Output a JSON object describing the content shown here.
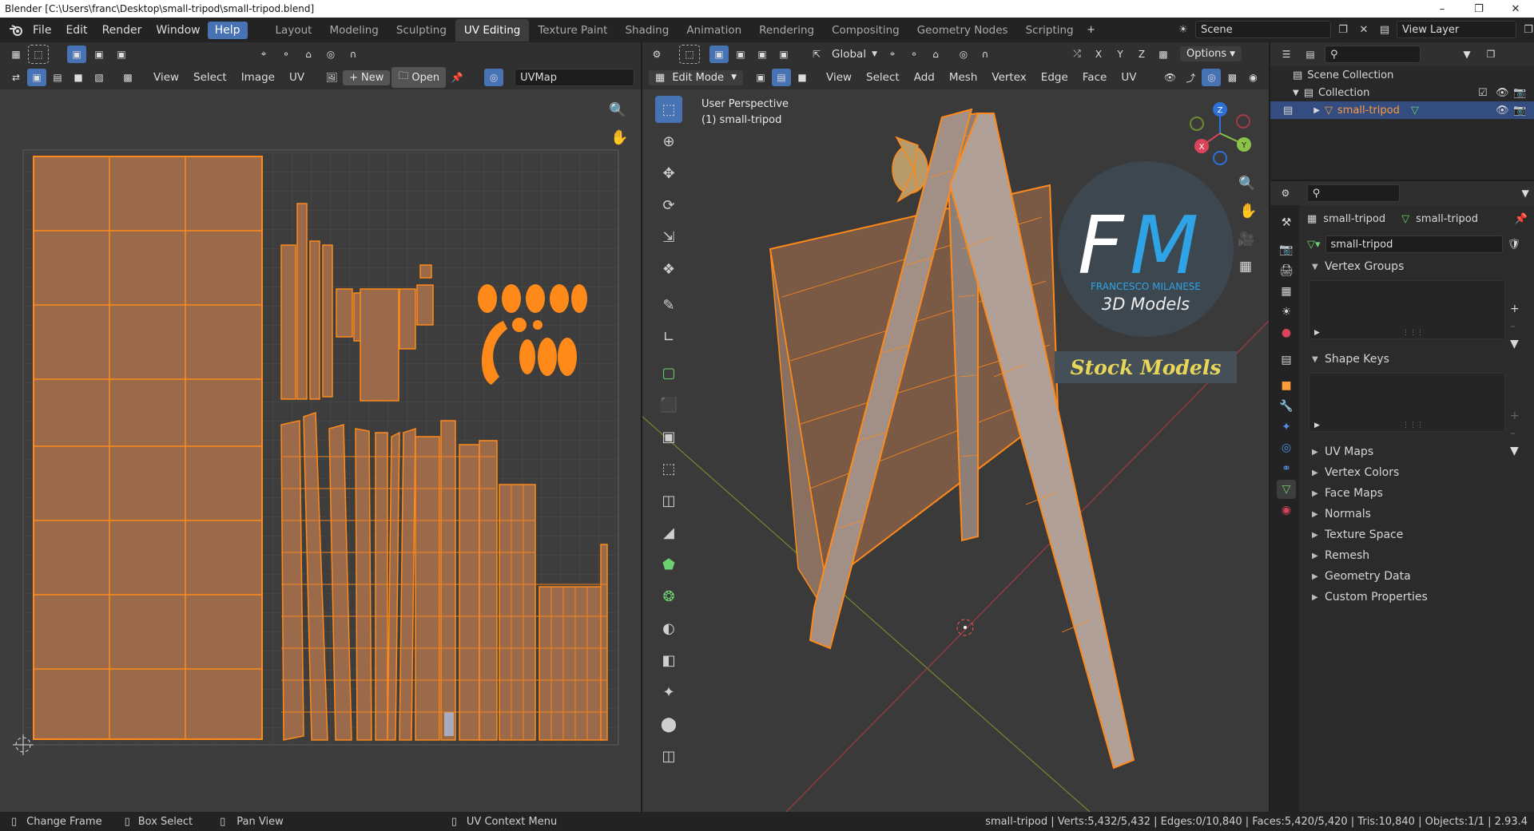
{
  "window": {
    "title": "Blender [C:\\Users\\franc\\Desktop\\small-tripod\\small-tripod.blend]"
  },
  "menus": [
    "File",
    "Edit",
    "Render",
    "Window",
    "Help"
  ],
  "workspaces": [
    "Layout",
    "Modeling",
    "Sculpting",
    "UV Editing",
    "Texture Paint",
    "Shading",
    "Animation",
    "Rendering",
    "Compositing",
    "Geometry Nodes",
    "Scripting"
  ],
  "scene": {
    "name": "Scene"
  },
  "view_layer": {
    "name": "View Layer"
  },
  "uv_editor": {
    "menus": [
      "View",
      "Select",
      "Image",
      "UV"
    ],
    "new_label": "New",
    "open_label": "Open",
    "uvmap": "UVMap"
  },
  "viewport": {
    "mode": "Edit Mode",
    "menus": [
      "View",
      "Select",
      "Add",
      "Mesh",
      "Vertex",
      "Edge",
      "Face",
      "UV"
    ],
    "orientation": "Global",
    "options_label": "Options",
    "view_name": "User Perspective",
    "object_label": "(1) small-tripod",
    "axes": [
      "X",
      "Y",
      "Z"
    ],
    "watermark": {
      "brand1": "F",
      "brand2": "M",
      "author": "FRANCESCO MILANESE",
      "sub": "3D Models",
      "tag": "Stock Models"
    }
  },
  "outliner": {
    "scene_collection": "Scene Collection",
    "collection": "Collection",
    "object": "small-tripod"
  },
  "properties": {
    "object_name": "small-tripod",
    "mesh_name": "small-tripod",
    "data_field": "small-tripod",
    "panels_open": [
      "Vertex Groups",
      "Shape Keys"
    ],
    "panels_closed": [
      "UV Maps",
      "Vertex Colors",
      "Face Maps",
      "Normals",
      "Texture Space",
      "Remesh",
      "Geometry Data",
      "Custom Properties"
    ]
  },
  "status": {
    "hints": [
      "Change Frame",
      "Box Select",
      "Pan View",
      "UV Context Menu"
    ],
    "stats": "small-tripod | Verts:5,432/5,432 | Edges:0/10,840 | Faces:5,420/5,420 | Tris:10,840 | Objects:1/1 | 2.93.4"
  },
  "colors": {
    "accent": "#4772b3",
    "selection": "#ff8a1a",
    "uv_fill": "#9a6a4a"
  }
}
